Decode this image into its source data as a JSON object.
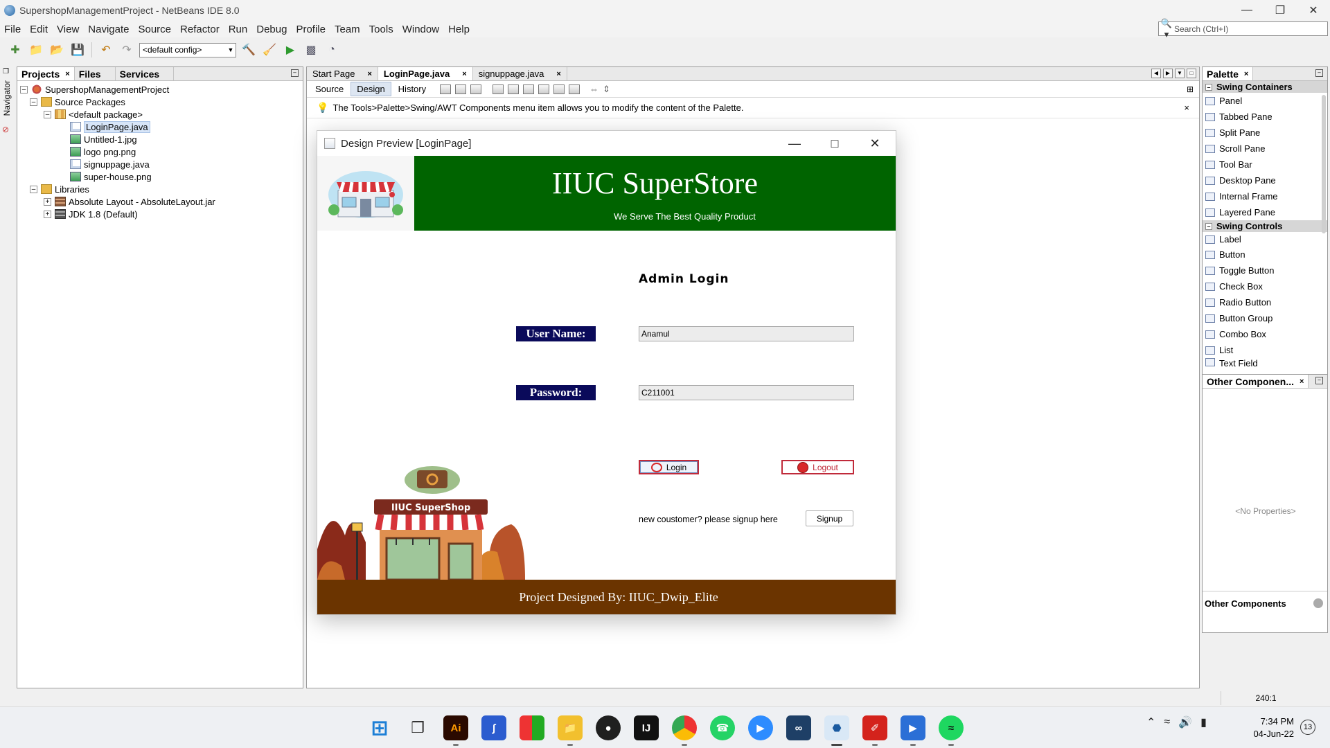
{
  "window": {
    "title": "SupershopManagementProject - NetBeans IDE 8.0"
  },
  "menu": [
    "File",
    "Edit",
    "View",
    "Navigate",
    "Source",
    "Refactor",
    "Run",
    "Debug",
    "Profile",
    "Team",
    "Tools",
    "Window",
    "Help"
  ],
  "search": {
    "placeholder": "Search (Ctrl+I)"
  },
  "toolbar": {
    "config": "<default config>"
  },
  "navigator": {
    "label": "Navigator"
  },
  "projects_panel": {
    "tabs": [
      "Projects",
      "Files",
      "Services"
    ],
    "tree": [
      {
        "label": "SupershopManagementProject",
        "level": 0,
        "icon": "project-icon"
      },
      {
        "label": "Source Packages",
        "level": 1,
        "icon": "folder-icon"
      },
      {
        "label": "<default package>",
        "level": 2,
        "icon": "package-icon"
      },
      {
        "label": "LoginPage.java",
        "level": 3,
        "icon": "java-file-icon",
        "selected": true
      },
      {
        "label": "Untitled-1.jpg",
        "level": 3,
        "icon": "image-file-icon"
      },
      {
        "label": "logo png.png",
        "level": 3,
        "icon": "image-file-icon"
      },
      {
        "label": "signuppage.java",
        "level": 3,
        "icon": "java-file-icon"
      },
      {
        "label": "super-house.png",
        "level": 3,
        "icon": "image-file-icon"
      },
      {
        "label": "Libraries",
        "level": 1,
        "icon": "folder-icon"
      },
      {
        "label": "Absolute Layout - AbsoluteLayout.jar",
        "level": 2,
        "icon": "jar-icon"
      },
      {
        "label": "JDK 1.8 (Default)",
        "level": 2,
        "icon": "library-icon"
      }
    ]
  },
  "editor": {
    "tabs": [
      "Start Page",
      "LoginPage.java",
      "signuppage.java"
    ],
    "active_tab": "LoginPage.java",
    "subtabs": [
      "Source",
      "Design",
      "History"
    ],
    "hint": "The Tools>Palette>Swing/AWT Components menu item allows you to modify the content of the Palette."
  },
  "preview": {
    "title": "Design Preview [LoginPage]",
    "store_title": "IIUC SuperStore",
    "tagline": "We Serve The Best Quality Product",
    "heading": "Admin Login",
    "username_label": "User Name:",
    "username_value": "Anamul",
    "password_label": "Password:",
    "password_value": "C211001",
    "login_button": "Login",
    "logout_button": "Logout",
    "signup_prompt": "new coustomer? please signup here",
    "signup_button": "Signup",
    "shop_sign": "IIUC SuperShop",
    "footer": "Project Designed By: IIUC_Dwip_Elite"
  },
  "palette": {
    "title": "Palette",
    "categories": [
      {
        "name": "Swing Containers",
        "items": [
          "Panel",
          "Tabbed Pane",
          "Split Pane",
          "Scroll Pane",
          "Tool Bar",
          "Desktop Pane",
          "Internal Frame",
          "Layered Pane"
        ]
      },
      {
        "name": "Swing Controls",
        "items": [
          "Label",
          "Button",
          "Toggle Button",
          "Check Box",
          "Radio Button",
          "Button Group",
          "Combo Box",
          "List",
          "Text Field"
        ]
      }
    ]
  },
  "other_components": {
    "title": "Other Componen...",
    "empty": "<No Properties>",
    "footer": "Other Components"
  },
  "status": {
    "position": "240:1"
  },
  "clock": {
    "time": "7:34 PM",
    "date": "04-Jun-22"
  },
  "notifications": {
    "count": "13"
  },
  "colors": {
    "header_green": "#006400",
    "footer_brown": "#6b3400",
    "label_navy": "#0a0a5a",
    "accent_red": "#c02a3a"
  }
}
